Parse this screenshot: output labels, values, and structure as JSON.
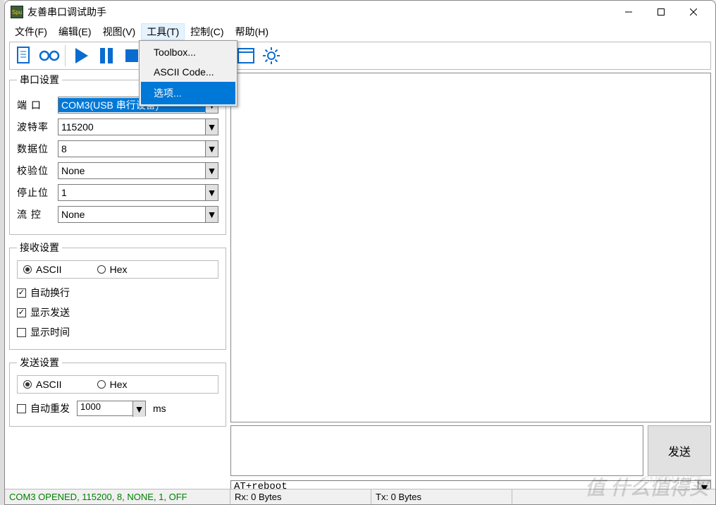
{
  "window": {
    "title": "友善串口调试助手"
  },
  "menubar": {
    "file": "文件(F)",
    "edit": "编辑(E)",
    "view": "视图(V)",
    "tools": "工具(T)",
    "control": "控制(C)",
    "help": "帮助(H)"
  },
  "tools_menu": {
    "toolbox": "Toolbox...",
    "ascii": "ASCII Code...",
    "options": "选项..."
  },
  "serial_settings": {
    "legend": "串口设置",
    "port_label": "端    口",
    "port_value": "COM3(USB 串行设备)",
    "baud_label": "波特率",
    "baud_value": "115200",
    "databits_label": "数据位",
    "databits_value": "8",
    "parity_label": "校验位",
    "parity_value": "None",
    "stopbits_label": "停止位",
    "stopbits_value": "1",
    "flow_label": "流    控",
    "flow_value": "None"
  },
  "recv_settings": {
    "legend": "接收设置",
    "ascii": "ASCII",
    "hex": "Hex",
    "auto_wrap": "自动换行",
    "show_send": "显示发送",
    "show_time": "显示时间"
  },
  "send_settings": {
    "legend": "发送设置",
    "ascii": "ASCII",
    "hex": "Hex",
    "auto_resend": "自动重发",
    "interval": "1000",
    "unit": "ms"
  },
  "send_button": "发送",
  "history_value": "AT+reboot",
  "statusbar": {
    "com": "COM3 OPENED, 115200, 8, NONE, 1, OFF",
    "rx": "Rx: 0 Bytes",
    "tx": "Tx: 0 Bytes"
  },
  "watermark": {
    "main": "值    什么值得买",
    "sub": "SMZDM.NET"
  }
}
